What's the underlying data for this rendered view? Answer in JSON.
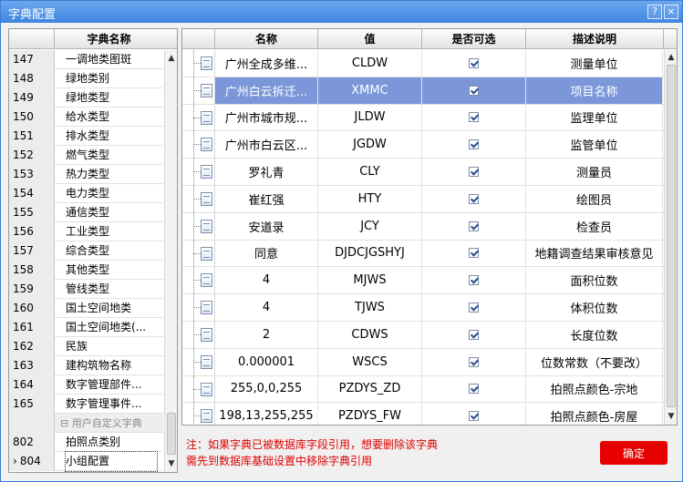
{
  "window": {
    "title": "字典配置",
    "help": "?",
    "close": "×"
  },
  "left": {
    "header": "字典名称",
    "rows": [
      {
        "num": "147",
        "name": "一调地类图斑"
      },
      {
        "num": "148",
        "name": "绿地类别"
      },
      {
        "num": "149",
        "name": "绿地类型"
      },
      {
        "num": "150",
        "name": "给水类型"
      },
      {
        "num": "151",
        "name": "排水类型"
      },
      {
        "num": "152",
        "name": "燃气类型"
      },
      {
        "num": "153",
        "name": "热力类型"
      },
      {
        "num": "154",
        "name": "电力类型"
      },
      {
        "num": "155",
        "name": "通信类型"
      },
      {
        "num": "156",
        "name": "工业类型"
      },
      {
        "num": "157",
        "name": "综合类型"
      },
      {
        "num": "158",
        "name": "其他类型"
      },
      {
        "num": "159",
        "name": "管线类型"
      },
      {
        "num": "160",
        "name": "国土空间地类"
      },
      {
        "num": "161",
        "name": "国土空间地类(..."
      },
      {
        "num": "162",
        "name": "民族"
      },
      {
        "num": "163",
        "name": "建构筑物名称"
      },
      {
        "num": "164",
        "name": "数字管理部件..."
      },
      {
        "num": "165",
        "name": "数字管理事件..."
      }
    ],
    "group_label": "⊟ 用户自定义字典",
    "custom_rows": [
      {
        "num": "802",
        "name": "拍照点类别"
      },
      {
        "num": "804",
        "name": "小组配置"
      }
    ],
    "current_marker": "›"
  },
  "right": {
    "headers": [
      "名称",
      "值",
      "是否可选",
      "描述说明"
    ],
    "rows": [
      {
        "name": "广州全成多维...",
        "value": "CLDW",
        "desc": "测量单位"
      },
      {
        "name": "广州白云拆迁...",
        "value": "XMMC",
        "desc": "项目名称"
      },
      {
        "name": "广州市城市规...",
        "value": "JLDW",
        "desc": "监理单位"
      },
      {
        "name": "广州市白云区...",
        "value": "JGDW",
        "desc": "监管单位"
      },
      {
        "name": "罗礼青",
        "value": "CLY",
        "desc": "测量员"
      },
      {
        "name": "崔红强",
        "value": "HTY",
        "desc": "绘图员"
      },
      {
        "name": "安道录",
        "value": "JCY",
        "desc": "检查员"
      },
      {
        "name": "同意",
        "value": "DJDCJGSHYJ",
        "desc": "地籍调查结果审核意见"
      },
      {
        "name": "4",
        "value": "MJWS",
        "desc": "面积位数"
      },
      {
        "name": "4",
        "value": "TJWS",
        "desc": "体积位数"
      },
      {
        "name": "2",
        "value": "CDWS",
        "desc": "长度位数"
      },
      {
        "name": "0.000001",
        "value": "WSCS",
        "desc": "位数常数（不要改）"
      },
      {
        "name": "255,0,0,255",
        "value": "PZDYS_ZD",
        "desc": "拍照点颜色-宗地"
      },
      {
        "name": "198,13,255,255",
        "value": "PZDYS_FW",
        "desc": "拍照点颜色-房屋"
      }
    ]
  },
  "note": {
    "line1": "注：如果字典已被数据库字段引用，想要删除该字典",
    "line2": "需先到数据库基础设置中移除字典引用"
  },
  "ok_label": "确定"
}
